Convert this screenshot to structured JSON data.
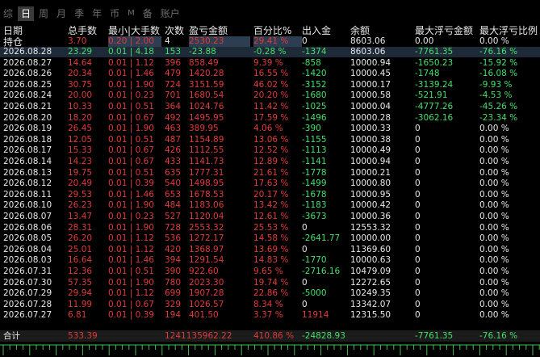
{
  "tabs": [
    {
      "label": "综",
      "active": false
    },
    {
      "label": "日",
      "active": true
    },
    {
      "label": "周",
      "active": false
    },
    {
      "label": "月",
      "active": false
    },
    {
      "label": "季",
      "active": false
    },
    {
      "label": "年",
      "active": false
    },
    {
      "label": "币",
      "active": false
    },
    {
      "label": "M",
      "active": false
    },
    {
      "label": "备",
      "active": false
    },
    {
      "label": "账户",
      "active": false
    }
  ],
  "headers": {
    "date": [
      "日期",
      "持仓"
    ],
    "lots": "总手数",
    "minmax": "最小|大手数",
    "count": "次数",
    "pnl": "盈亏金额",
    "pct": "百分比%",
    "flow": "出入金",
    "balance": "余额",
    "max_float": "最大浮亏金额",
    "max_float_pct": "最大浮亏比例"
  },
  "position_row": {
    "lots": "3.70",
    "minmax": "0.20 | 2.00",
    "count": "4",
    "pnl": "2530.23",
    "pct": "29.41 %",
    "flow": "0",
    "balance": "8603.06",
    "max_float": "0.00",
    "max_float_pct": "0.00 %"
  },
  "rows": [
    {
      "date": "2026.08.28",
      "lots": "23.29",
      "minmax": "0.01 | 4.18",
      "count": "153",
      "pnl": "-23.88",
      "pct": "-0.28 %",
      "flow": "-1374",
      "balance": "8603.06",
      "max_float": "-7761.35",
      "max_float_pct": "-76.16 %"
    },
    {
      "date": "2026.08.27",
      "lots": "14.64",
      "minmax": "0.01 | 1.12",
      "count": "396",
      "pnl": "858.49",
      "pct": "9.39 %",
      "flow": "-858",
      "balance": "10000.94",
      "max_float": "-1650.23",
      "max_float_pct": "-15.92 %"
    },
    {
      "date": "2026.08.26",
      "lots": "20.34",
      "minmax": "0.01 | 1.46",
      "count": "479",
      "pnl": "1420.28",
      "pct": "16.55 %",
      "flow": "-1420",
      "balance": "10000.45",
      "max_float": "-1748",
      "max_float_pct": "-16.08 %"
    },
    {
      "date": "2026.08.25",
      "lots": "30.75",
      "minmax": "0.01 | 1.90",
      "count": "724",
      "pnl": "3151.59",
      "pct": "46.02 %",
      "flow": "-3152",
      "balance": "10000.17",
      "max_float": "-3139.24",
      "max_float_pct": "-9.93 %"
    },
    {
      "date": "2026.08.24",
      "lots": "20.00",
      "minmax": "0.01 | 0.23",
      "count": "701",
      "pnl": "1680.54",
      "pct": "20.20 %",
      "flow": "-1680",
      "balance": "10000.58",
      "max_float": "-521.91",
      "max_float_pct": "-4.53 %"
    },
    {
      "date": "2026.08.21",
      "lots": "10.33",
      "minmax": "0.01 | 0.51",
      "count": "364",
      "pnl": "1024.76",
      "pct": "11.42 %",
      "flow": "-1025",
      "balance": "10000.04",
      "max_float": "-4777.26",
      "max_float_pct": "-45.26 %"
    },
    {
      "date": "2026.08.20",
      "lots": "18.20",
      "minmax": "0.01 | 0.67",
      "count": "492",
      "pnl": "1495.95",
      "pct": "17.59 %",
      "flow": "-1496",
      "balance": "10000.28",
      "max_float": "-3062.16",
      "max_float_pct": "-23.34 %"
    },
    {
      "date": "2026.08.19",
      "lots": "26.45",
      "minmax": "0.01 | 1.90",
      "count": "463",
      "pnl": "389.95",
      "pct": "4.06 %",
      "flow": "-390",
      "balance": "10000.33",
      "max_float": "0",
      "max_float_pct": "0.00 %"
    },
    {
      "date": "2026.08.18",
      "lots": "12.05",
      "minmax": "0.01 | 0.51",
      "count": "487",
      "pnl": "1154.89",
      "pct": "13.06 %",
      "flow": "-1155",
      "balance": "10000.38",
      "max_float": "0",
      "max_float_pct": "0.00 %"
    },
    {
      "date": "2026.08.17",
      "lots": "15.33",
      "minmax": "0.01 | 0.67",
      "count": "426",
      "pnl": "1112.55",
      "pct": "12.52 %",
      "flow": "-1113",
      "balance": "10000.49",
      "max_float": "0",
      "max_float_pct": "0.00 %"
    },
    {
      "date": "2026.08.14",
      "lots": "14.23",
      "minmax": "0.01 | 0.67",
      "count": "433",
      "pnl": "1141.73",
      "pct": "12.89 %",
      "flow": "-1141",
      "balance": "10000.94",
      "max_float": "0",
      "max_float_pct": "0.00 %"
    },
    {
      "date": "2026.08.13",
      "lots": "19.75",
      "minmax": "0.01 | 0.51",
      "count": "635",
      "pnl": "1777.31",
      "pct": "21.61 %",
      "flow": "-1778",
      "balance": "10000.21",
      "max_float": "0",
      "max_float_pct": "0.00 %"
    },
    {
      "date": "2026.08.12",
      "lots": "20.49",
      "minmax": "0.01 | 0.39",
      "count": "540",
      "pnl": "1498.95",
      "pct": "17.63 %",
      "flow": "-1499",
      "balance": "10000.80",
      "max_float": "0",
      "max_float_pct": "0.00 %"
    },
    {
      "date": "2026.08.11",
      "lots": "29.53",
      "minmax": "0.01 | 1.46",
      "count": "653",
      "pnl": "1678.53",
      "pct": "20.17 %",
      "flow": "-1678",
      "balance": "10000.95",
      "max_float": "0",
      "max_float_pct": "0.00 %"
    },
    {
      "date": "2026.08.10",
      "lots": "26.23",
      "minmax": "0.01 | 1.90",
      "count": "484",
      "pnl": "1183.06",
      "pct": "13.42 %",
      "flow": "-1183",
      "balance": "10000.42",
      "max_float": "0",
      "max_float_pct": "0.00 %"
    },
    {
      "date": "2026.08.07",
      "lots": "13.47",
      "minmax": "0.01 | 0.23",
      "count": "527",
      "pnl": "1120.04",
      "pct": "12.61 %",
      "flow": "-3673",
      "balance": "10000.36",
      "max_float": "0",
      "max_float_pct": "0.00 %"
    },
    {
      "date": "2026.08.06",
      "lots": "28.31",
      "minmax": "0.01 | 1.90",
      "count": "728",
      "pnl": "2553.32",
      "pct": "25.53 %",
      "flow": "0",
      "balance": "12553.32",
      "max_float": "0",
      "max_float_pct": "0.00 %"
    },
    {
      "date": "2026.08.05",
      "lots": "26.20",
      "minmax": "0.01 | 1.12",
      "count": "536",
      "pnl": "1272.17",
      "pct": "14.58 %",
      "flow": "-2641.77",
      "balance": "10000.00",
      "max_float": "0",
      "max_float_pct": "0.00 %"
    },
    {
      "date": "2026.08.04",
      "lots": "25.01",
      "minmax": "0.01 | 1.12",
      "count": "420",
      "pnl": "1368.97",
      "pct": "13.69 %",
      "flow": "0",
      "balance": "11369.60",
      "max_float": "0",
      "max_float_pct": "0.00 %"
    },
    {
      "date": "2026.08.03",
      "lots": "16.64",
      "minmax": "0.01 | 1.46",
      "count": "394",
      "pnl": "1291.54",
      "pct": "14.83 %",
      "flow": "-1770",
      "balance": "10000.63",
      "max_float": "0",
      "max_float_pct": "0.00 %"
    },
    {
      "date": "2026.07.31",
      "lots": "12.36",
      "minmax": "0.01 | 0.51",
      "count": "390",
      "pnl": "922.60",
      "pct": "9.65 %",
      "flow": "-2716.16",
      "balance": "10479.09",
      "max_float": "0",
      "max_float_pct": "0.00 %"
    },
    {
      "date": "2026.07.30",
      "lots": "57.35",
      "minmax": "0.01 | 1.90",
      "count": "780",
      "pnl": "2023.30",
      "pct": "19.74 %",
      "flow": "0",
      "balance": "12272.65",
      "max_float": "0",
      "max_float_pct": "0.00 %"
    },
    {
      "date": "2026.07.29",
      "lots": "29.94",
      "minmax": "0.01 | 1.12",
      "count": "699",
      "pnl": "1907.28",
      "pct": "22.86 %",
      "flow": "-5000",
      "balance": "10249.35",
      "max_float": "0",
      "max_float_pct": "0.00 %"
    },
    {
      "date": "2026.07.28",
      "lots": "11.99",
      "minmax": "0.01 | 0.67",
      "count": "329",
      "pnl": "1026.57",
      "pct": "8.34 %",
      "flow": "0",
      "balance": "13342.07",
      "max_float": "0",
      "max_float_pct": "0.00 %"
    },
    {
      "date": "2026.07.27",
      "lots": "6.81",
      "minmax": "0.01 | 0.39",
      "count": "194",
      "pnl": "401.50",
      "pct": "3.37 %",
      "flow": "11914",
      "balance": "12315.50",
      "max_float": "0",
      "max_float_pct": "0.00 %"
    }
  ],
  "total": {
    "label": "合计",
    "lots": "533.39",
    "count_pnl": "1241135962.22",
    "pct": "410.86 %",
    "flow": "-24828.93",
    "max_float": "-7761.35",
    "max_float_pct": "-76.16 %"
  },
  "colors": {
    "positive": "#e03a3a",
    "negative": "#41e06a",
    "neutral": "#e8e8e8",
    "highlight": "#1e2a38",
    "background": "#000000",
    "ticks": "#41c24a"
  }
}
